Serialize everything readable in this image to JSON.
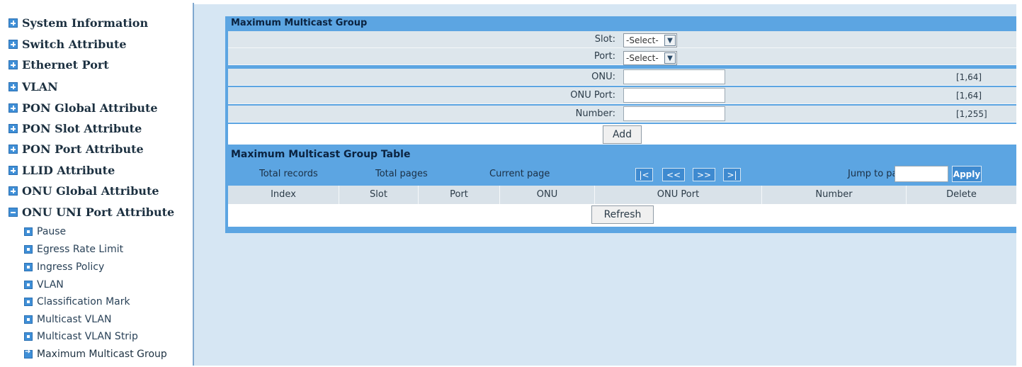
{
  "sidebar": {
    "items": [
      {
        "label": "System Information",
        "icon": "plus-icon"
      },
      {
        "label": "Switch Attribute",
        "icon": "plus-icon"
      },
      {
        "label": "Ethernet Port",
        "icon": "plus-icon"
      },
      {
        "label": "VLAN",
        "icon": "plus-icon"
      },
      {
        "label": "PON Global Attribute",
        "icon": "plus-icon"
      },
      {
        "label": "PON Slot Attribute",
        "icon": "plus-icon"
      },
      {
        "label": "PON Port Attribute",
        "icon": "plus-icon"
      },
      {
        "label": "LLID Attribute",
        "icon": "plus-icon"
      },
      {
        "label": "ONU Global Attribute",
        "icon": "plus-icon"
      },
      {
        "label": "ONU UNI Port Attribute",
        "icon": "minus-icon"
      }
    ],
    "subitems": [
      {
        "label": "Pause"
      },
      {
        "label": "Egress Rate Limit"
      },
      {
        "label": "Ingress Policy"
      },
      {
        "label": "VLAN"
      },
      {
        "label": "Classification Mark"
      },
      {
        "label": "Multicast VLAN"
      },
      {
        "label": "Multicast VLAN Strip"
      },
      {
        "label": "Maximum Multicast Group"
      }
    ]
  },
  "form": {
    "title": "Maximum Multicast Group",
    "slot_label": "Slot:",
    "slot_value": "-Select-",
    "port_label": "Port:",
    "port_value": "-Select-",
    "onu_label": "ONU:",
    "onu_value": "",
    "onu_range": "[1,64]",
    "onu_port_label": "ONU Port:",
    "onu_port_value": "",
    "onu_port_range": "[1,64]",
    "number_label": "Number:",
    "number_value": "",
    "number_range": "[1,255]",
    "add_label": "Add"
  },
  "table": {
    "title": "Maximum Multicast Group Table",
    "total_records_label": "Total records",
    "total_pages_label": "Total pages",
    "current_page_label": "Current page",
    "first_label": "|<",
    "prev_label": "<<",
    "next_label": ">>",
    "last_label": ">|",
    "jump_label": "Jump to page",
    "jump_value": "",
    "apply_label": "Apply",
    "columns": [
      "Index",
      "Slot",
      "Port",
      "ONU",
      "ONU Port",
      "Number",
      "Delete"
    ],
    "refresh_label": "Refresh"
  },
  "colors": {
    "header_bar": "#5ca5e2",
    "content_bg": "#d6e6f3",
    "row_bg": "#dde6ec",
    "nav_button": "#3e8ad0"
  }
}
